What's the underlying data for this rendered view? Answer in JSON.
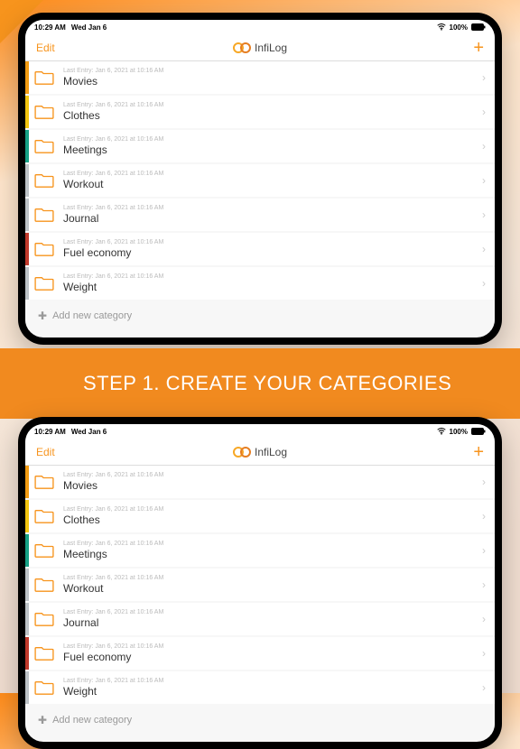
{
  "status": {
    "time": "10:29 AM",
    "date": "Wed Jan 6",
    "battery": "100%"
  },
  "nav": {
    "edit": "Edit",
    "title": "InfiLog",
    "add": "+"
  },
  "categories": [
    {
      "title": "Movies",
      "sub": "Last Entry: Jan 6, 2021 at 10:16 AM",
      "color": "#f39c12"
    },
    {
      "title": "Clothes",
      "sub": "Last Entry: Jan 6, 2021 at 10:16 AM",
      "color": "#f1c40f"
    },
    {
      "title": "Meetings",
      "sub": "Last Entry: Jan 6, 2021 at 10:16 AM",
      "color": "#16a085"
    },
    {
      "title": "Workout",
      "sub": "Last Entry: Jan 6, 2021 at 10:16 AM",
      "color": "#bdc3c7"
    },
    {
      "title": "Journal",
      "sub": "Last Entry: Jan 6, 2021 at 10:16 AM",
      "color": "#bdc3c7"
    },
    {
      "title": "Fuel economy",
      "sub": "Last Entry: Jan 6, 2021 at 10:16 AM",
      "color": "#c0392b"
    },
    {
      "title": "Weight",
      "sub": "Last Entry: Jan 6, 2021 at 10:16 AM",
      "color": "#bdc3c7"
    }
  ],
  "addCategory": "Add new category",
  "banner": "STEP 1. CREATE YOUR CATEGORIES"
}
